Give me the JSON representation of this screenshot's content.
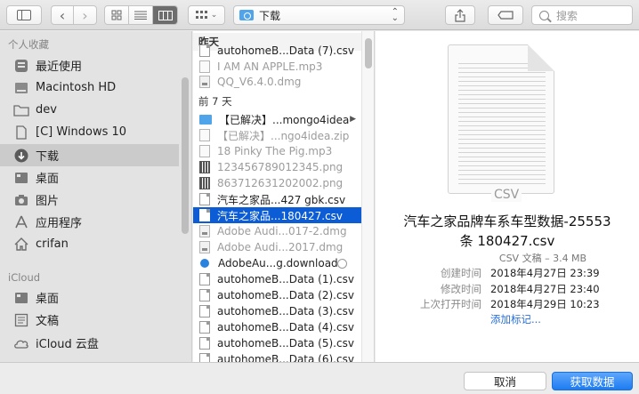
{
  "toolbar": {
    "path_label": "下载",
    "search_placeholder": "搜索"
  },
  "sidebar": {
    "favorites_header": "个人收藏",
    "favorites": [
      {
        "label": "最近使用",
        "icon": "recents-icon"
      },
      {
        "label": "Macintosh HD",
        "icon": "harddisk-icon"
      },
      {
        "label": "dev",
        "icon": "folder-icon"
      },
      {
        "label": "[C] Windows 10",
        "icon": "document-icon"
      },
      {
        "label": "下载",
        "icon": "downloads-icon",
        "selected": true
      },
      {
        "label": "桌面",
        "icon": "desktop-icon"
      },
      {
        "label": "图片",
        "icon": "camera-icon"
      },
      {
        "label": "应用程序",
        "icon": "applications-icon"
      },
      {
        "label": "crifan",
        "icon": "home-icon"
      }
    ],
    "icloud_header": "iCloud",
    "icloud": [
      {
        "label": "桌面",
        "icon": "desktop-icon"
      },
      {
        "label": "文稿",
        "icon": "documents-icon"
      },
      {
        "label": "iCloud 云盘",
        "icon": "icloud-icon"
      }
    ]
  },
  "files": {
    "group_yesterday": "昨天",
    "yesterday": [
      {
        "name": "autohomeB...Data (7).csv",
        "kind": "doc"
      },
      {
        "name": "I AM AN APPLE.mp3",
        "kind": "note",
        "dim": true
      },
      {
        "name": "QQ_V6.4.0.dmg",
        "kind": "dmg",
        "dim": true
      }
    ],
    "group_week": "前 7 天",
    "week": [
      {
        "name": "【已解决】...mongo4idea",
        "kind": "folder",
        "has_children": true
      },
      {
        "name": "【已解决】...ngo4idea.zip",
        "kind": "note",
        "dim": true
      },
      {
        "name": "18 Pinky The Pig.mp3",
        "kind": "note",
        "dim": true
      },
      {
        "name": "123456789012345.png",
        "kind": "qr",
        "dim": true
      },
      {
        "name": "863712631202002.png",
        "kind": "qr",
        "dim": true
      },
      {
        "name": "汽车之家品...427 gbk.csv",
        "kind": "doc"
      },
      {
        "name": "汽车之家品...180427.csv",
        "kind": "doc",
        "selected": true
      },
      {
        "name": "Adobe Audi...017-2.dmg",
        "kind": "dmg",
        "dim": true
      },
      {
        "name": "Adobe Audi...2017.dmg",
        "kind": "dmg",
        "dim": true
      },
      {
        "name": "AdobeAu...g.download",
        "kind": "dl",
        "downloading": true
      },
      {
        "name": "autohomeB...Data (1).csv",
        "kind": "doc"
      },
      {
        "name": "autohomeB...Data (2).csv",
        "kind": "doc"
      },
      {
        "name": "autohomeB...Data (3).csv",
        "kind": "doc"
      },
      {
        "name": "autohomeB...Data (4).csv",
        "kind": "doc"
      },
      {
        "name": "autohomeB...Data (5).csv",
        "kind": "doc"
      },
      {
        "name": "autohomeB...Data (6).csv",
        "kind": "doc"
      }
    ]
  },
  "preview": {
    "thumb_label": "CSV",
    "title_line1": "汽车之家品牌车系车型数据-25553",
    "title_line2": "条 180427.csv",
    "subtitle": "CSV 文稿 – 3.4 MB",
    "meta": [
      {
        "key": "创建时间",
        "value": "2018年4月27日 23:39"
      },
      {
        "key": "修改时间",
        "value": "2018年4月27日 23:40"
      },
      {
        "key": "上次打开时间",
        "value": "2018年4月29日 10:23"
      }
    ],
    "add_tags": "添加标记..."
  },
  "footer": {
    "cancel_label": "取消",
    "ok_label": "获取数据"
  }
}
